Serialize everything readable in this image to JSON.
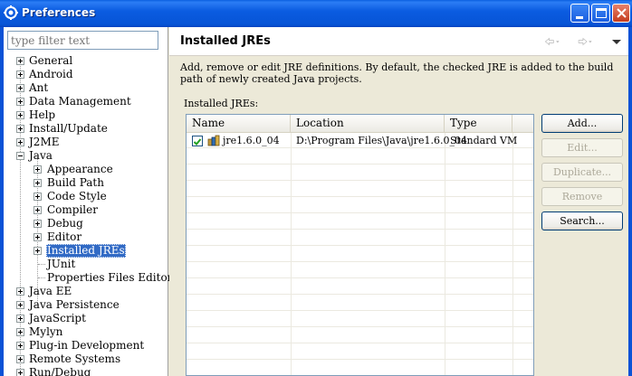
{
  "window": {
    "title": "Preferences"
  },
  "filter": {
    "placeholder": "type filter text"
  },
  "tree": {
    "items": [
      {
        "label": "General",
        "expander": "plus"
      },
      {
        "label": "Android",
        "expander": "plus"
      },
      {
        "label": "Ant",
        "expander": "plus"
      },
      {
        "label": "Data Management",
        "expander": "plus"
      },
      {
        "label": "Help",
        "expander": "plus"
      },
      {
        "label": "Install/Update",
        "expander": "plus"
      },
      {
        "label": "J2ME",
        "expander": "plus"
      },
      {
        "label": "Java",
        "expander": "minus"
      },
      {
        "label": "Appearance",
        "expander": "plus"
      },
      {
        "label": "Build Path",
        "expander": "plus"
      },
      {
        "label": "Code Style",
        "expander": "plus"
      },
      {
        "label": "Compiler",
        "expander": "plus"
      },
      {
        "label": "Debug",
        "expander": "plus"
      },
      {
        "label": "Editor",
        "expander": "plus"
      },
      {
        "label": "Installed JREs",
        "expander": "plus",
        "selected": true
      },
      {
        "label": "JUnit",
        "expander": "none"
      },
      {
        "label": "Properties Files Editor",
        "expander": "none"
      },
      {
        "label": "Java EE",
        "expander": "plus"
      },
      {
        "label": "Java Persistence",
        "expander": "plus"
      },
      {
        "label": "JavaScript",
        "expander": "plus"
      },
      {
        "label": "Mylyn",
        "expander": "plus"
      },
      {
        "label": "Plug-in Development",
        "expander": "plus"
      },
      {
        "label": "Remote Systems",
        "expander": "plus"
      },
      {
        "label": "Run/Debug",
        "expander": "plus"
      }
    ]
  },
  "page": {
    "title": "Installed JREs",
    "description": "Add, remove or edit JRE definitions. By default, the checked JRE is added to the build path of newly created Java projects.",
    "table_label": "Installed JREs:"
  },
  "table": {
    "columns": [
      "Name",
      "Location",
      "Type"
    ],
    "rows": [
      {
        "checked": true,
        "name": "jre1.6.0_04",
        "location": "D:\\Program Files\\Java\\jre1.6.0_04",
        "type": "Standard VM"
      }
    ]
  },
  "buttons": {
    "add": "Add...",
    "edit": "Edit...",
    "duplicate": "Duplicate...",
    "remove": "Remove",
    "search": "Search..."
  },
  "icons": {
    "back": "back-arrow-icon",
    "forward": "forward-arrow-icon",
    "menu": "view-menu-icon",
    "jre": "jre-library-icon"
  },
  "colors": {
    "titlebar": "#0a5fe0",
    "selection": "#316ac5"
  }
}
